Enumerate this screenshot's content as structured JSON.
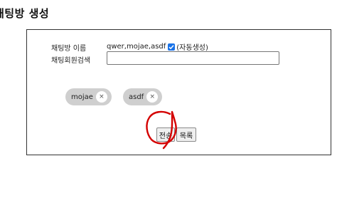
{
  "page": {
    "title": "채팅방 생성"
  },
  "form": {
    "room_name_label": "채팅방 이름",
    "room_name_value": "qwer,mojae,asdf",
    "auto_generate_label": "(자동생성)",
    "auto_generate_checked": true,
    "member_search_label": "채팅회원검색",
    "member_search_value": ""
  },
  "members": [
    {
      "name": "mojae",
      "remove_symbol": "×"
    },
    {
      "name": "asdf",
      "remove_symbol": "×"
    }
  ],
  "buttons": {
    "submit_label": "전송",
    "list_label": "목록"
  },
  "colors": {
    "checkbox": "#1a73e8",
    "chip_background": "#cfcfcf",
    "annotation": "#d40000"
  }
}
